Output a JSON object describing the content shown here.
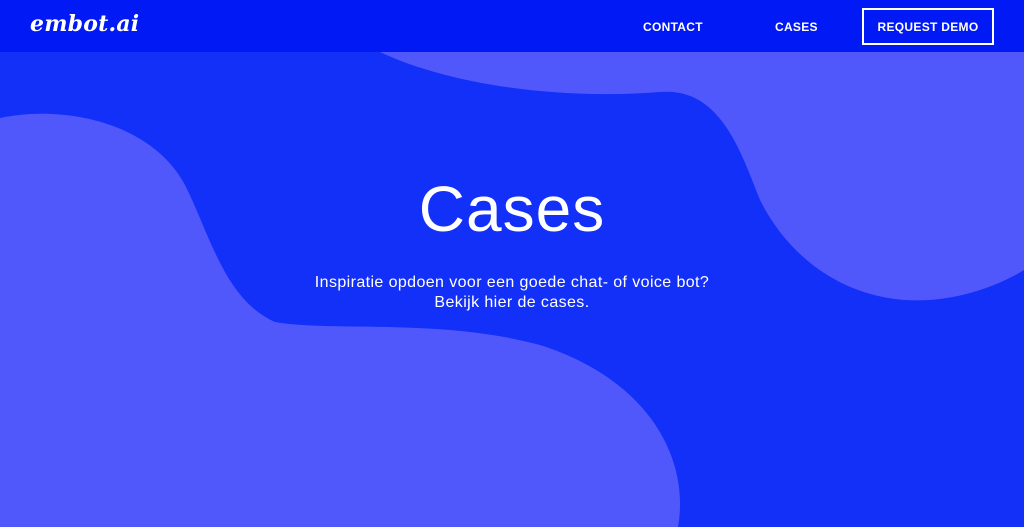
{
  "brand": {
    "logo_text": "embot.ai"
  },
  "nav": {
    "contact_label": "CONTACT",
    "cases_label": "CASES",
    "request_demo_label": "REQUEST DEMO"
  },
  "hero": {
    "title": "Cases",
    "subtitle_line1": "Inspiratie opdoen voor een goede chat- of voice bot?",
    "subtitle_line2": "Bekijk hier de cases."
  },
  "colors": {
    "nav_background": "#0019f5",
    "hero_background": "#1230f7",
    "blob": "#5158fb",
    "text": "#ffffff"
  }
}
